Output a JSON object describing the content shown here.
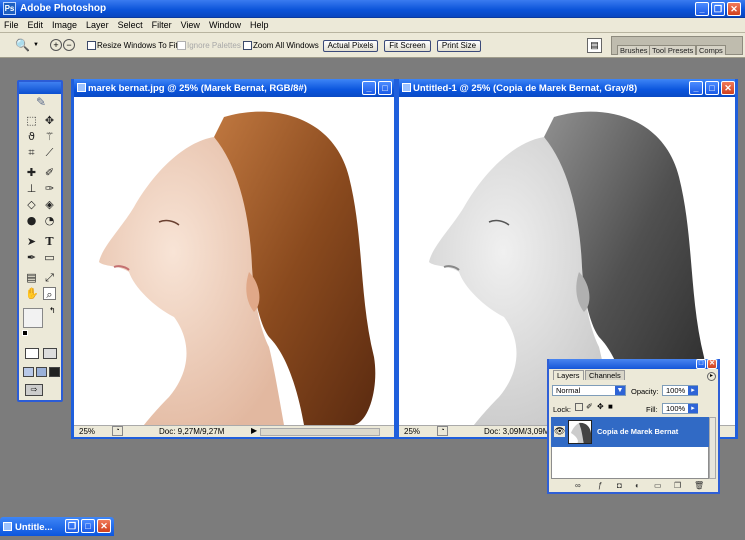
{
  "app": {
    "title": "Adobe Photoshop"
  },
  "menu": [
    "File",
    "Edit",
    "Image",
    "Layer",
    "Select",
    "Filter",
    "View",
    "Window",
    "Help"
  ],
  "options": {
    "resize_windows": "Resize Windows To Fit",
    "ignore_palettes": "Ignore Palettes",
    "zoom_all": "Zoom All Windows",
    "actual_pixels": "Actual Pixels",
    "fit_screen": "Fit Screen",
    "print_size": "Print Size"
  },
  "palette_well": {
    "tabs": [
      "Brushes",
      "Tool Presets",
      "Comps"
    ]
  },
  "doc1": {
    "title": "marek bernat.jpg @ 25% (Marek Bernat, RGB/8#)",
    "zoom": "25%",
    "doc_info": "Doc: 9,27M/9,27M"
  },
  "doc2": {
    "title": "Untitled-1 @ 25% (Copia de Marek Bernat, Gray/8)",
    "zoom": "25%",
    "doc_info": "Doc: 3,09M/3,09M"
  },
  "layers": {
    "tabs": [
      "Layers",
      "Channels"
    ],
    "blend_mode": "Normal",
    "opacity_label": "Opacity:",
    "opacity": "100%",
    "lock_label": "Lock:",
    "fill_label": "Fill:",
    "fill": "100%",
    "layer_name": "Copia de Marek Bernat"
  },
  "minimized": {
    "title": "Untitle..."
  },
  "colors": {
    "titlebar": "#0a52d8",
    "chrome": "#ece9d8",
    "workspace": "#7c7c7c",
    "hair": "#8a4a1e"
  }
}
